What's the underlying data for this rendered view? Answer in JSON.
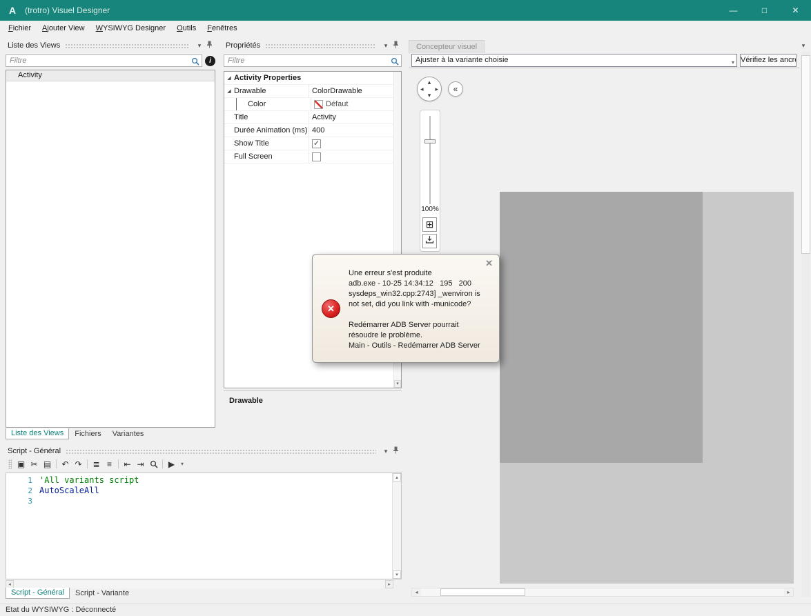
{
  "window": {
    "title": "(trotro) Visuel Designer",
    "app_initial": "A"
  },
  "menu": {
    "items": [
      "Fichier",
      "Ajouter View",
      "WYSIWYG Designer",
      "Outils",
      "Fenêtres"
    ]
  },
  "icons": {
    "minimize": "—",
    "maximize": "□",
    "close": "✕",
    "dropdown": "▾",
    "expanded": "◢",
    "up": "▴",
    "down": "▾",
    "left": "◂",
    "right": "▸",
    "collapse": "«",
    "check": "✓",
    "info": "i",
    "error": "✕",
    "overflow": "⋮",
    "fit": "⊞"
  },
  "views_panel": {
    "title": "Liste des Views",
    "filter_placeholder": "Filtre",
    "items": [
      "Activity"
    ],
    "tabs": [
      "Liste des Views",
      "Fichiers",
      "Variantes"
    ]
  },
  "properties_panel": {
    "title": "Propriétés",
    "filter_placeholder": "Filtre",
    "category": "Activity Properties",
    "drawable": {
      "name": "Drawable",
      "value": "ColorDrawable"
    },
    "color": {
      "name": "Color",
      "value": "Défaut"
    },
    "title_row": {
      "name": "Title",
      "value": "Activity"
    },
    "duration": {
      "name": "Durée Animation (ms)",
      "value": "400"
    },
    "show_title": {
      "name": "Show Title",
      "checked": true
    },
    "full_screen": {
      "name": "Full Screen",
      "checked": false
    },
    "description_title": "Drawable"
  },
  "designer": {
    "tab": "Concepteur visuel",
    "variant_selector": "Ajuster à la variante choisie",
    "anchors_button": "Vérifiez les ancres.",
    "zoom_level": "100%"
  },
  "error_popup": {
    "lines": [
      "Une erreur s'est produite",
      "adb.exe - 10-25 14:34:12   195   200",
      "sysdeps_win32.cpp:2743] _wenviron is",
      "not set, did you link with -municode?",
      "",
      "Redémarrer ADB Server pourrait",
      "résoudre le problème.",
      "Main - Outils - Redémarrer ADB Server"
    ]
  },
  "script_panel": {
    "title": "Script - Général",
    "toolbar": [
      {
        "name": "copy",
        "glyph": "▣"
      },
      {
        "name": "cut",
        "glyph": "✂"
      },
      {
        "name": "paste",
        "glyph": "▤"
      },
      {
        "name": "undo",
        "glyph": "↶"
      },
      {
        "name": "redo",
        "glyph": "↷"
      },
      {
        "name": "comment-selection",
        "glyph": "≣"
      },
      {
        "name": "uncomment-selection",
        "glyph": "≡"
      },
      {
        "name": "decrease-indent",
        "glyph": "⇤"
      },
      {
        "name": "increase-indent",
        "glyph": "⇥"
      },
      {
        "name": "search",
        "glyph": ""
      },
      {
        "name": "run",
        "glyph": "▶"
      }
    ],
    "lines": [
      {
        "number": "1",
        "code": "'All variants script",
        "kind": "comment"
      },
      {
        "number": "2",
        "code": "AutoScaleAll",
        "kind": "identifier"
      },
      {
        "number": "3",
        "code": "",
        "kind": "plain"
      }
    ],
    "tabs": [
      "Script - Général",
      "Script - Variante"
    ]
  },
  "status_bar": {
    "text": "Etat du WYSIWYG : Déconnecté"
  }
}
